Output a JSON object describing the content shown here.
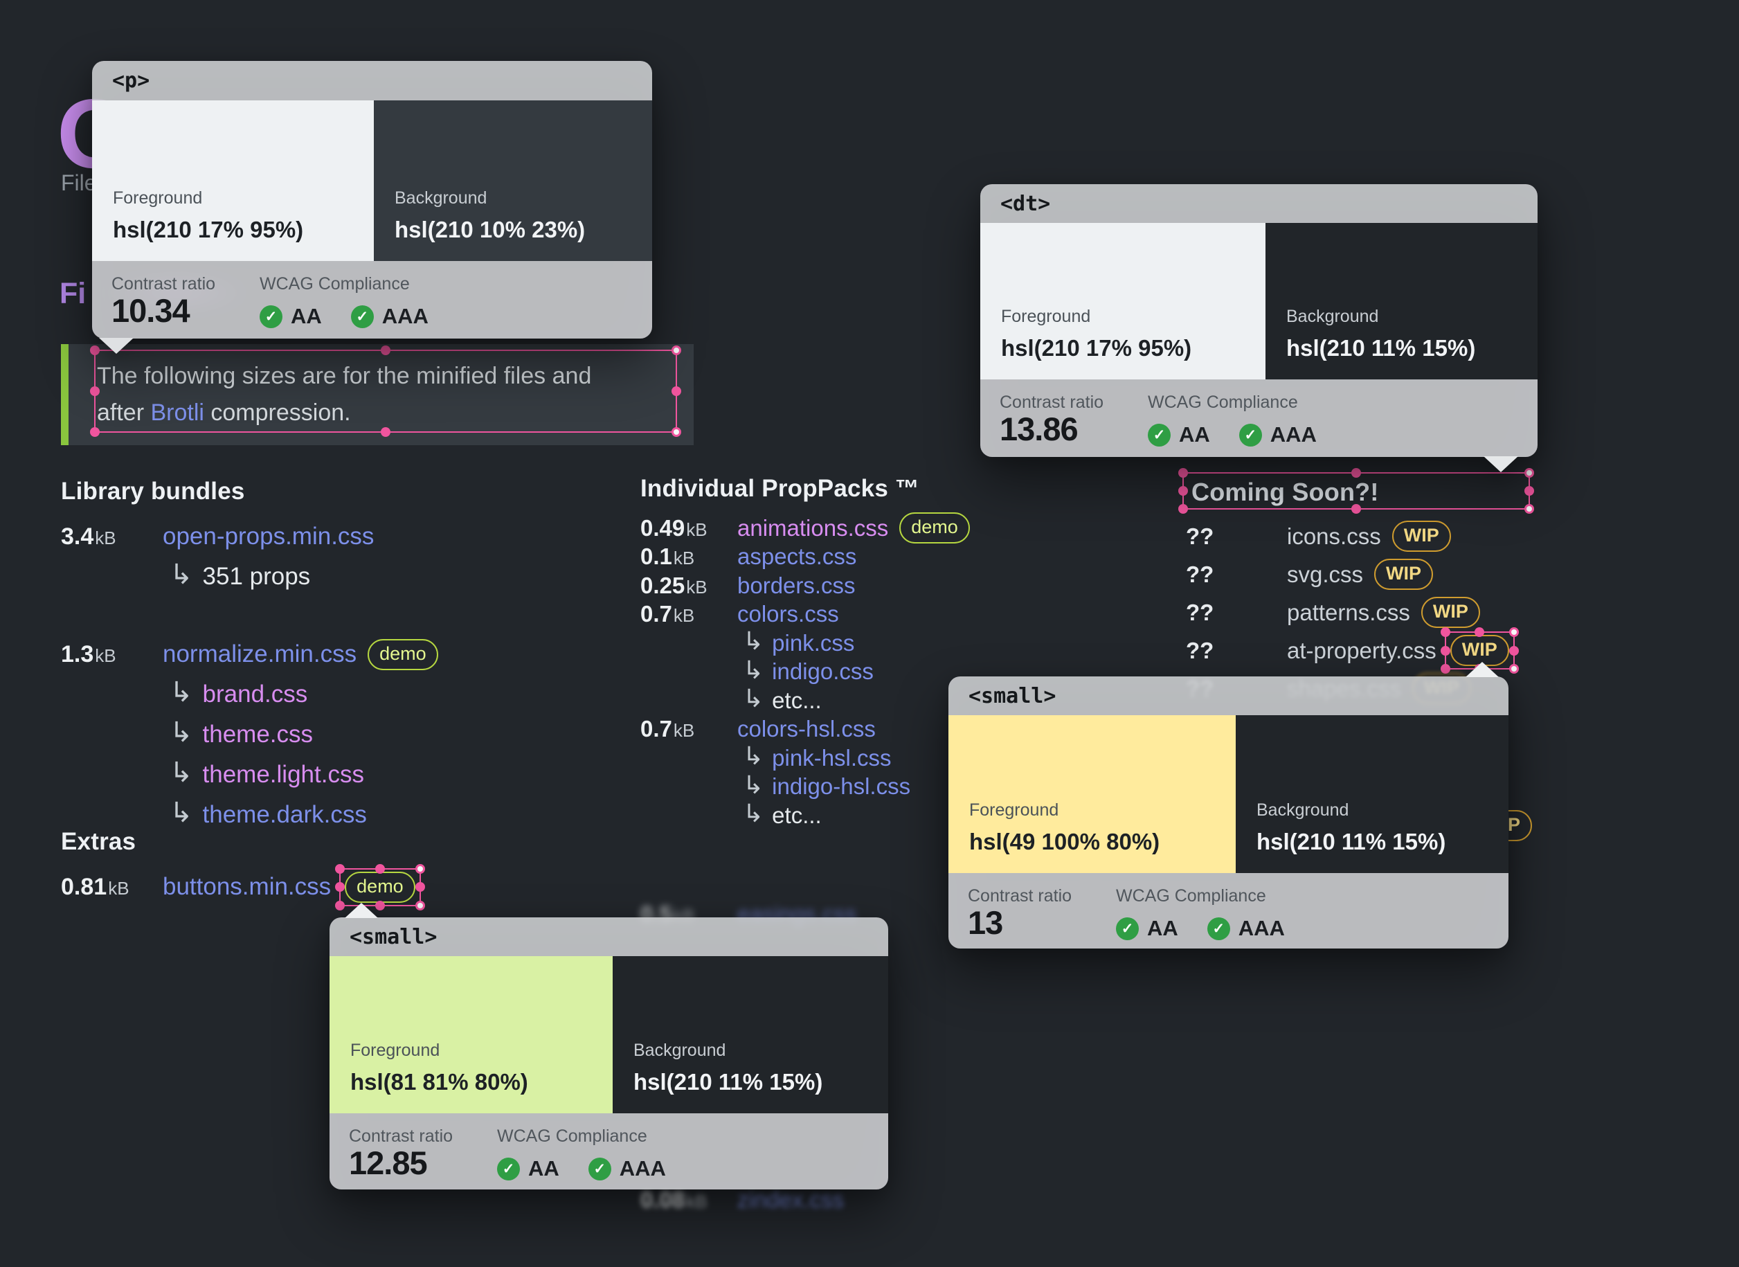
{
  "colors": {
    "page_bg": "#22262b",
    "selection_pink": "#f0559e",
    "link_indigo": "#7d90ea",
    "link_violet": "#d88df0",
    "demo_badge_green": "#b6d740",
    "wip_badge_gold": "#cf9c2f",
    "check_green": "#2f9e44",
    "quote_border_lime": "#8ac63e",
    "title_purple": "#c78cec"
  },
  "background_text": {
    "title_fragment": "O",
    "paragraph_fragment": "File",
    "heading_fragment": "Fi"
  },
  "quote": {
    "line1": "The following sizes are for the minified files and",
    "line2_pre": "after ",
    "link": "Brotli",
    "line2_post": " compression."
  },
  "cards": [
    {
      "tag": "<p>",
      "fg_label": "Foreground",
      "fg_value": "hsl(210 17% 95%)",
      "bg_label": "Background",
      "bg_value": "hsl(210 10% 23%)",
      "ratio_label": "Contrast ratio",
      "ratio": "10.34",
      "wcag_label": "WCAG Compliance",
      "aa": "AA",
      "aaa": "AAA"
    },
    {
      "tag": "<dt>",
      "fg_label": "Foreground",
      "fg_value": "hsl(210 17% 95%)",
      "bg_label": "Background",
      "bg_value": "hsl(210 11% 15%)",
      "ratio_label": "Contrast ratio",
      "ratio": "13.86",
      "wcag_label": "WCAG Compliance",
      "aa": "AA",
      "aaa": "AAA"
    },
    {
      "tag": "<small>",
      "fg_label": "Foreground",
      "fg_value": "hsl(49 100% 80%)",
      "bg_label": "Background",
      "bg_value": "hsl(210 11% 15%)",
      "ratio_label": "Contrast ratio",
      "ratio": "13",
      "wcag_label": "WCAG Compliance",
      "aa": "AA",
      "aaa": "AAA"
    },
    {
      "tag": "<small>",
      "fg_label": "Foreground",
      "fg_value": "hsl(81 81% 80%)",
      "bg_label": "Background",
      "bg_value": "hsl(210 11% 15%)",
      "ratio_label": "Contrast ratio",
      "ratio": "12.85",
      "wcag_label": "WCAG Compliance",
      "aa": "AA",
      "aaa": "AAA"
    }
  ],
  "library": {
    "heading": "Library bundles",
    "items": [
      {
        "size": "3.4",
        "unit": "kB",
        "name": "open-props.min.css",
        "style": "indigo",
        "link": true
      },
      {
        "sub": true,
        "name": "351 props",
        "style": "plain"
      },
      {
        "size": "1.3",
        "unit": "kB",
        "name": "normalize.min.css",
        "style": "indigo",
        "link": true,
        "badge": "demo",
        "group_start": true
      },
      {
        "sub": true,
        "name": "brand.css",
        "style": "violet",
        "link": true
      },
      {
        "sub": true,
        "name": "theme.css",
        "style": "violet",
        "link": true
      },
      {
        "sub": true,
        "name": "theme.light.css",
        "style": "violet",
        "link": true
      },
      {
        "sub": true,
        "name": "theme.dark.css",
        "style": "indigo",
        "link": true
      }
    ]
  },
  "extras": {
    "heading": "Extras",
    "items": [
      {
        "size": "0.81",
        "unit": "kB",
        "name": "buttons.min.css",
        "style": "indigo",
        "link": true,
        "badge": "demo",
        "badge_selected": true
      }
    ]
  },
  "proppacks": {
    "heading": "Individual PropPacks ™",
    "items": [
      {
        "size": "0.49",
        "unit": "kB",
        "name": "animations.css",
        "style": "violet",
        "link": true,
        "badge": "demo"
      },
      {
        "size": "0.1",
        "unit": "kB",
        "name": "aspects.css",
        "style": "indigo",
        "link": true
      },
      {
        "size": "0.25",
        "unit": "kB",
        "name": "borders.css",
        "style": "indigo",
        "link": true
      },
      {
        "size": "0.7",
        "unit": "kB",
        "name": "colors.css",
        "style": "indigo",
        "link": true
      },
      {
        "sub": true,
        "name": "pink.css",
        "style": "indigo",
        "link": true
      },
      {
        "sub": true,
        "name": "indigo.css",
        "style": "indigo",
        "link": true
      },
      {
        "sub": true,
        "name": "etc...",
        "style": "plain"
      },
      {
        "size": "0.7",
        "unit": "kB",
        "name": "colors-hsl.css",
        "style": "indigo",
        "link": true
      },
      {
        "sub": true,
        "name": "pink-hsl.css",
        "style": "indigo",
        "link": true
      },
      {
        "sub": true,
        "name": "indigo-hsl.css",
        "style": "indigo",
        "link": true
      },
      {
        "sub": true,
        "name": "etc...",
        "style": "plain"
      }
    ],
    "ghost_easings": {
      "size": "0.5",
      "unit": "kB",
      "name": "easings.css",
      "style": "indigo"
    },
    "ghost_zindex": {
      "size": "0.08",
      "unit": "kB",
      "name": "zindex.css",
      "style": "indigo"
    }
  },
  "coming": {
    "heading": "Coming Soon?!",
    "items": [
      {
        "q": "??",
        "name": "icons.css",
        "style": "gray",
        "badge": "WIP"
      },
      {
        "q": "??",
        "name": "svg.css",
        "style": "gray",
        "badge": "WIP"
      },
      {
        "q": "??",
        "name": "patterns.css",
        "style": "gray",
        "badge": "WIP"
      },
      {
        "q": "??",
        "name": "at-property.css",
        "style": "gray",
        "badge": "WIP",
        "badge_selected": true
      },
      {
        "q": "??",
        "name": "shapes.css",
        "style": "gray",
        "badge": "WIP",
        "blur": true
      }
    ],
    "ghost_wip_label": "WIP"
  }
}
